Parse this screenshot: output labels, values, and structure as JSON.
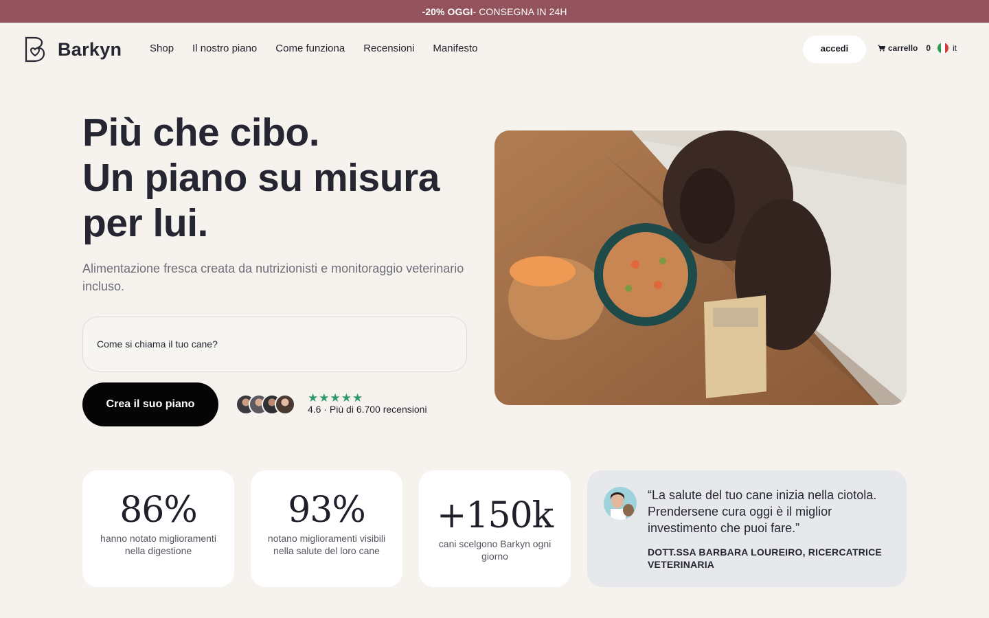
{
  "promo": {
    "highlight": "-20% OGGI",
    "rest": " - CONSEGNA IN 24H"
  },
  "header": {
    "logo_text": "Barkyn",
    "nav": [
      "Shop",
      "Il nostro piano",
      "Come funziona",
      "Recensioni",
      "Manifesto"
    ],
    "login_label": "accedi",
    "cart_label": "carrello",
    "cart_count": "0",
    "language": "it"
  },
  "hero": {
    "title_lines": [
      "Più che cibo.",
      "Un piano su misura",
      "per lui."
    ],
    "subtitle": "Alimentazione fresca creata da nutrizionisti e monitoraggio veterinario incluso.",
    "input_placeholder": "Come si chiama il tuo cane?",
    "cta_label": "Crea il suo piano",
    "stars": "★★★★★",
    "rating_text": "4.6 · Più di 6.700 recensioni"
  },
  "stats": [
    {
      "value": "86%",
      "label": "hanno notato miglioramenti nella digestione"
    },
    {
      "value": "93%",
      "label": "notano miglioramenti visibili nella salute del loro cane"
    },
    {
      "value": "+150k",
      "label": "cani scelgono Barkyn ogni giorno"
    }
  ],
  "testimonial": {
    "quote": "“La salute del tuo cane inizia nella ciotola. Prendersene cura oggi è il miglior investimento che puoi fare.”",
    "author": "DOTT.SSA BARBARA LOUREIRO, RICERCATRICE VETERINARIA"
  },
  "colors": {
    "promo_bg": "#93535d",
    "page_bg": "#f6f3ee",
    "cta_bg": "#050505",
    "star": "#2e9a6a",
    "quote_bg": "#e7e8ec"
  }
}
